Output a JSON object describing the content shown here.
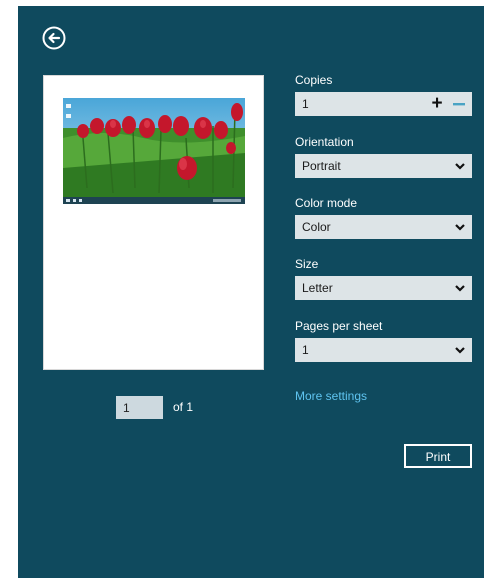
{
  "copies": {
    "label": "Copies",
    "value": "1",
    "plus_icon": "plus-icon",
    "minus_icon": "minus-icon"
  },
  "orientation": {
    "label": "Orientation",
    "value": "Portrait"
  },
  "color_mode": {
    "label": "Color mode",
    "value": "Color"
  },
  "size": {
    "label": "Size",
    "value": "Letter"
  },
  "pages_per_sheet": {
    "label": "Pages per sheet",
    "value": "1"
  },
  "more_settings": "More settings",
  "print_label": "Print",
  "page_nav": {
    "current": "1",
    "of_label": "of 1"
  },
  "icons": {
    "back": "back-arrow-icon",
    "dropdown": "chevron-down-icon"
  },
  "colors": {
    "panel_bg": "#0f4a5e",
    "field_bg": "#dde4e7",
    "link": "#5fc4f0",
    "text": "#ffffff"
  }
}
